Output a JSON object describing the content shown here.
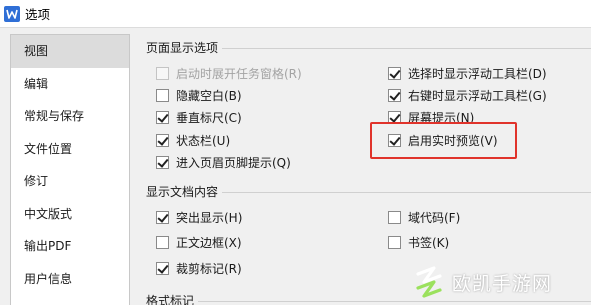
{
  "window": {
    "title": "选项"
  },
  "sidebar": {
    "items": [
      {
        "label": "视图",
        "active": true
      },
      {
        "label": "编辑"
      },
      {
        "label": "常规与保存"
      },
      {
        "label": "文件位置"
      },
      {
        "label": "修订"
      },
      {
        "label": "中文版式"
      },
      {
        "label": "输出PDF"
      },
      {
        "label": "用户信息"
      }
    ]
  },
  "sections": {
    "page_display": {
      "title": "页面显示选项",
      "left": [
        {
          "label": "启动时展开任务窗格(R)",
          "checked": false,
          "disabled": true
        },
        {
          "label": "隐藏空白(B)",
          "checked": false
        },
        {
          "label": "垂直标尺(C)",
          "checked": true
        },
        {
          "label": "状态栏(U)",
          "checked": true
        },
        {
          "label": "进入页眉页脚提示(Q)",
          "checked": true
        }
      ],
      "right": [
        {
          "label": "选择时显示浮动工具栏(D)",
          "checked": true
        },
        {
          "label": "右键时显示浮动工具栏(G)",
          "checked": true
        },
        {
          "label": "屏幕提示(N)",
          "checked": true
        },
        {
          "label": "启用实时预览(V)",
          "checked": true,
          "highlighted": true
        }
      ]
    },
    "doc_content": {
      "title": "显示文档内容",
      "left": [
        {
          "label": "突出显示(H)",
          "checked": true
        },
        {
          "label": "正文边框(X)",
          "checked": false
        },
        {
          "label": "裁剪标记(R)",
          "checked": true
        }
      ],
      "right": [
        {
          "label": "域代码(F)",
          "checked": false
        },
        {
          "label": "书签(K)",
          "checked": false
        }
      ]
    },
    "format_marks": {
      "title": "格式标记"
    }
  },
  "watermark": {
    "text": "欧凯手游网"
  },
  "colors": {
    "highlight": "#e0332b",
    "app_icon": "#2f6fd6",
    "active_nav": "#dcdcdc"
  }
}
